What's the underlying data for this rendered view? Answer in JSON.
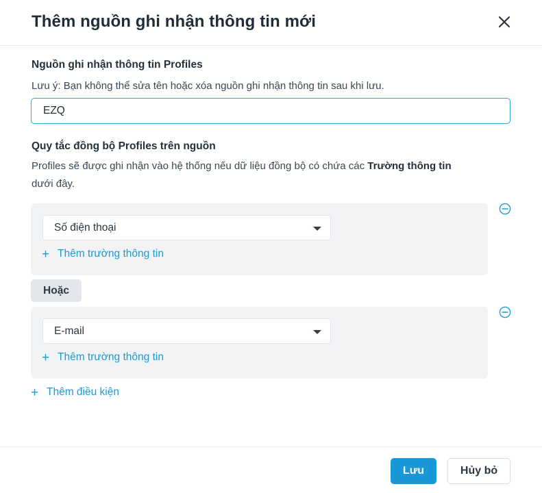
{
  "dialog": {
    "title": "Thêm nguồn ghi nhận thông tin mới",
    "close_icon": "close-icon"
  },
  "source": {
    "label": "Nguồn ghi nhận thông tin Profiles",
    "note": "Lưu ý: Bạn không thể sửa tên hoặc xóa nguồn ghi nhận thông tin sau khi lưu.",
    "value": "EZQ"
  },
  "rules": {
    "label": "Quy tắc đồng bộ Profiles trên nguồn",
    "desc_prefix": "Profiles sẽ được ghi nhận vào hệ thống nếu dữ liệu đồng bộ có chứa các ",
    "desc_bold": "Trường thông tin",
    "desc_suffix": "dưới đây.",
    "groups": [
      {
        "field": "Số điện thoại",
        "add_field_label": "Thêm trường thông tin"
      },
      {
        "field": "E-mail",
        "add_field_label": "Thêm trường thông tin"
      }
    ],
    "or_label": "Hoặc",
    "add_condition_label": "Thêm điều kiện"
  },
  "footer": {
    "save_label": "Lưu",
    "cancel_label": "Hủy bỏ"
  },
  "colors": {
    "accent": "#1898d6",
    "link": "#1d9ad3",
    "input_focus_border": "#2fa7c8",
    "group_bg": "#f1f3f5"
  }
}
